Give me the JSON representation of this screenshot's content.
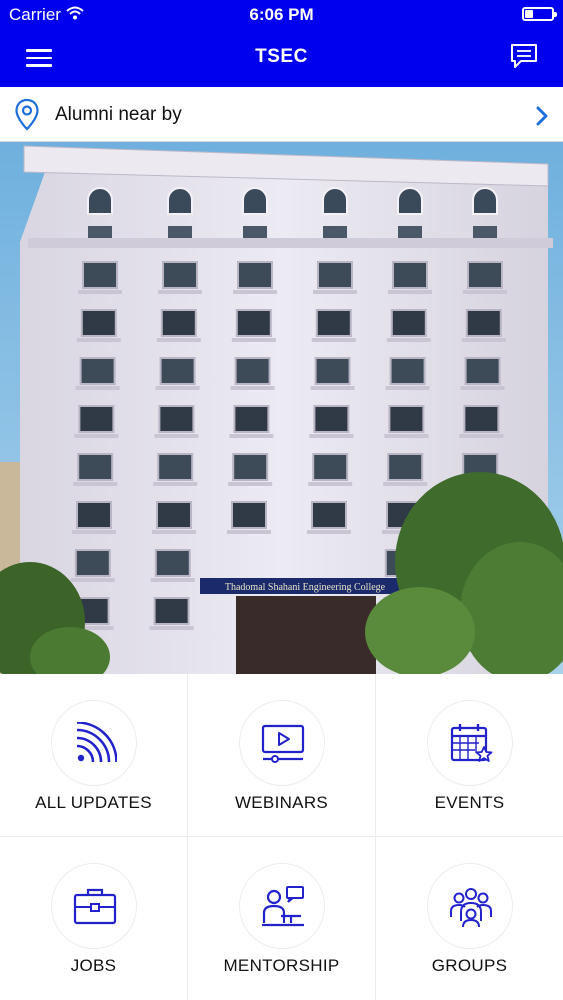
{
  "status_bar": {
    "carrier": "Carrier",
    "time": "6:06 PM"
  },
  "header": {
    "title": "TSEC"
  },
  "alumni_row": {
    "label": "Alumni near by"
  },
  "banner": {
    "signboard_text": "Thadomal Shahani Engineering College"
  },
  "colors": {
    "header_bg": "#0000ee",
    "icon_blue": "#2222cc",
    "chevron_blue": "#1e6fd9"
  },
  "tiles": [
    {
      "label": "ALL UPDATES",
      "icon": "rss-feed-icon"
    },
    {
      "label": "WEBINARS",
      "icon": "video-play-icon"
    },
    {
      "label": "EVENTS",
      "icon": "calendar-star-icon"
    },
    {
      "label": "JOBS",
      "icon": "briefcase-icon"
    },
    {
      "label": "MENTORSHIP",
      "icon": "mentor-icon"
    },
    {
      "label": "GROUPS",
      "icon": "group-people-icon"
    }
  ]
}
